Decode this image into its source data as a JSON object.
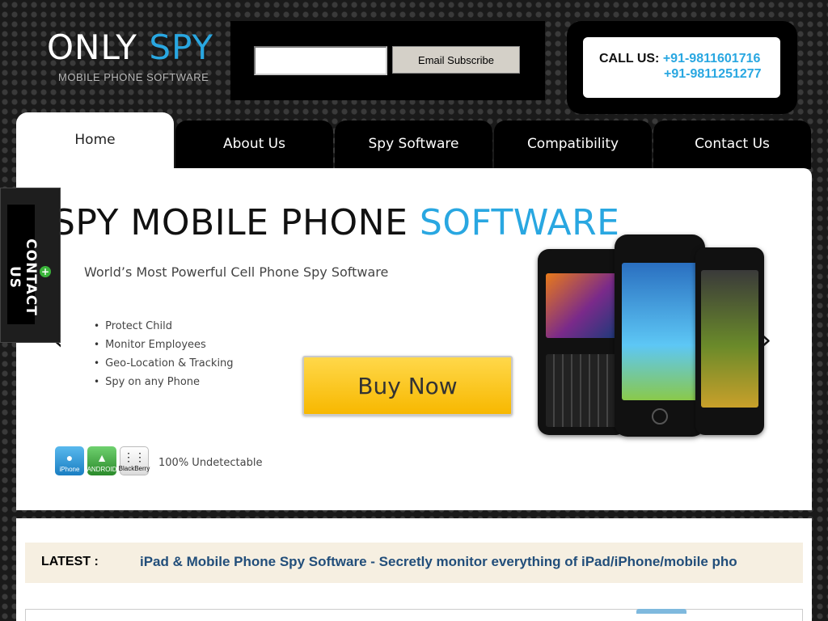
{
  "logo": {
    "title_main": "ONLY",
    "title_accent": "SPY",
    "subtitle": "MOBILE PHONE SOFTWARE"
  },
  "subscribe": {
    "value": "",
    "placeholder": "",
    "button_label": "Email Subscribe"
  },
  "call": {
    "label": "CALL US:",
    "numbers": [
      "+91-9811601716",
      "+91-9811251277"
    ]
  },
  "nav": {
    "tabs": [
      "Home",
      "About Us",
      "Spy Software",
      "Compatibility",
      "Contact Us"
    ],
    "active": "Home"
  },
  "banner": {
    "title_main": "SPY MOBILE PHONE",
    "title_accent": "SOFTWARE",
    "subtitle": "World’s Most Powerful Cell Phone Spy Software",
    "features": [
      "Protect Child",
      "Monitor Employees",
      "Geo-Location & Tracking",
      "Spy on any Phone"
    ],
    "buy_label": "Buy Now",
    "platforms": [
      "iPhone",
      "ANDROID",
      "BlackBerry"
    ],
    "undetectable": "100% Undetectable",
    "prev_arrow": "‹",
    "next_arrow": "›"
  },
  "contact_tab": {
    "label": "CONTACT US",
    "plus": "+"
  },
  "latest": {
    "label": "LATEST :",
    "text": "iPad & Mobile Phone Spy Software - Secretly monitor everything of iPad/iPhone/mobile pho"
  },
  "colors": {
    "accent": "#29a7e1",
    "latest_bg": "#f6efe1",
    "latest_text": "#224e7a",
    "buy_button": "#f7c21a"
  },
  "icons": {
    "prev": "chevron-left-icon",
    "next": "chevron-right-icon",
    "plus": "plus-icon"
  }
}
